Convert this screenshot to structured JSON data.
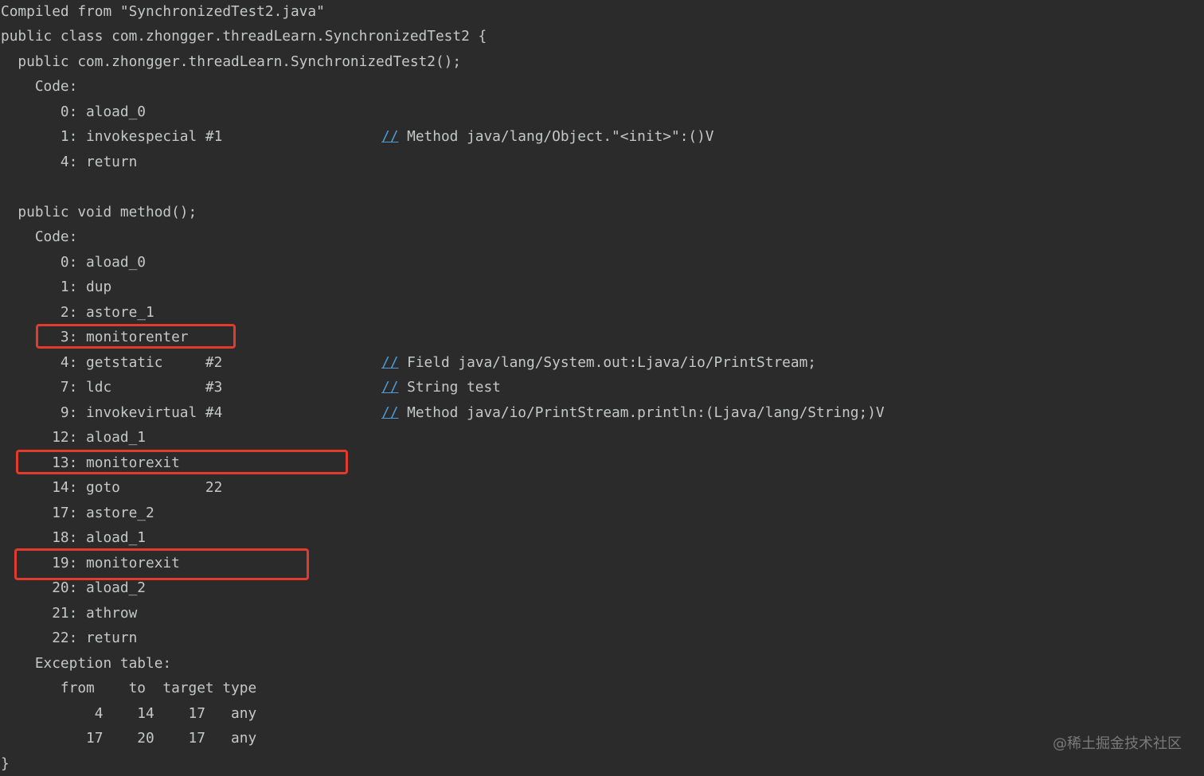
{
  "console": {
    "lines": [
      {
        "code": "Compiled from \"SynchronizedTest2.java\"",
        "comment": ""
      },
      {
        "code": "public class com.zhongger.threadLearn.SynchronizedTest2 {",
        "comment": ""
      },
      {
        "code": "  public com.zhongger.threadLearn.SynchronizedTest2();",
        "comment": ""
      },
      {
        "code": "    Code:",
        "comment": ""
      },
      {
        "code": "       0: aload_0",
        "comment": ""
      },
      {
        "code": "       1: invokespecial #1",
        "comment": " Method java/lang/Object.\"<init>\":()V"
      },
      {
        "code": "       4: return",
        "comment": ""
      },
      {
        "code": "",
        "comment": ""
      },
      {
        "code": "  public void method();",
        "comment": ""
      },
      {
        "code": "    Code:",
        "comment": ""
      },
      {
        "code": "       0: aload_0",
        "comment": ""
      },
      {
        "code": "       1: dup",
        "comment": ""
      },
      {
        "code": "       2: astore_1",
        "comment": ""
      },
      {
        "code": "       3: monitorenter",
        "comment": ""
      },
      {
        "code": "       4: getstatic     #2",
        "comment": " Field java/lang/System.out:Ljava/io/PrintStream;"
      },
      {
        "code": "       7: ldc           #3",
        "comment": " String test"
      },
      {
        "code": "       9: invokevirtual #4",
        "comment": " Method java/io/PrintStream.println:(Ljava/lang/String;)V"
      },
      {
        "code": "      12: aload_1",
        "comment": ""
      },
      {
        "code": "      13: monitorexit",
        "comment": ""
      },
      {
        "code": "      14: goto          22",
        "comment": ""
      },
      {
        "code": "      17: astore_2",
        "comment": ""
      },
      {
        "code": "      18: aload_1",
        "comment": ""
      },
      {
        "code": "      19: monitorexit",
        "comment": ""
      },
      {
        "code": "      20: aload_2",
        "comment": ""
      },
      {
        "code": "      21: athrow",
        "comment": ""
      },
      {
        "code": "      22: return",
        "comment": ""
      },
      {
        "code": "    Exception table:",
        "comment": ""
      },
      {
        "code": "       from    to  target type",
        "comment": ""
      },
      {
        "code": "           4    14    17   any",
        "comment": ""
      },
      {
        "code": "          17    20    17   any",
        "comment": ""
      },
      {
        "code": "}",
        "comment": ""
      }
    ],
    "comment_marker": "//",
    "highlighted_instructions": [
      "3: monitorenter",
      "13: monitorexit",
      "19: monitorexit"
    ]
  },
  "watermark": "@稀土掘金技术社区",
  "colors": {
    "background": "#2b2b2b",
    "text": "#c5c8c6",
    "comment_marker": "#4e9cd6",
    "highlight_border": "#e23a2c",
    "watermark": "#7a7a7a"
  }
}
